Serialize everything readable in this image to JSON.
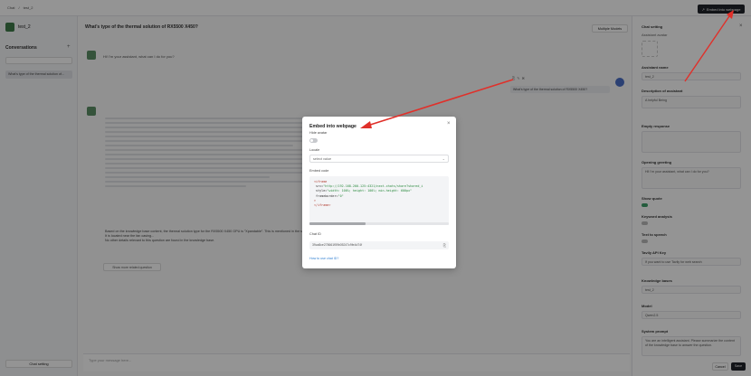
{
  "topbar": {
    "breadcrumb": [
      "Chat",
      "/",
      "test_2"
    ],
    "embed_button": "Embed into webpage"
  },
  "sidebar": {
    "app_name": "test_2",
    "section_title": "Conversations",
    "conversation": "What's type of the thermal solution of...",
    "chat_setting": "Chat setting"
  },
  "main": {
    "question_title": "What's type of the thermal solution of RX5500 X450?",
    "multiple_models": "Multiple Models",
    "greeting": "Hi! I'm your assistant, what can I do for you?",
    "user_question": "What's type of the thermal solution of RX5500 X450?",
    "answer": "Based on the knowledge base content, the thermal solution type for the RX5500 X450 GPU is \"Xpandable\". This is mentioned in the section... which is available in the document. For a detailed breakdown...",
    "answer_line2": "It is located near the fan casing...",
    "answer_line3": "No other details relevant to this question are found in the knowledge base.",
    "related": "Show more related question",
    "input_placeholder": "Type your message here..."
  },
  "right_panel": {
    "title": "Chat setting",
    "assistant_avatar": "Assistant avatar",
    "assistant_name_label": "Assistant name",
    "assistant_name": "test_2",
    "description_label": "Description of assistant",
    "description": "A helpful Being",
    "empty_response_label": "Empty response",
    "opening_greeting_label": "Opening greeting",
    "opening_greeting": "Hi! I'm your assistant, what can I do for you?",
    "show_quote_label": "Show quote",
    "keyword_label": "Keyword analysis",
    "text_to_speech_label": "Text to speech",
    "tavily_label": "Tavily API Key",
    "tavily_placeholder": "If you want to use Tavily for web search",
    "knowledge_bases_label": "Knowledge bases",
    "knowledge_base": "test_2",
    "model_label": "Model",
    "model_value": "Qwen2.5",
    "system_prompt_label": "System prompt",
    "system_prompt": "You are an intelligent assistant. Please summarize the content of the knowledge base to answer the question.",
    "cancel": "Cancel",
    "save": "Save"
  },
  "modal": {
    "title": "Embed into webpage",
    "hide_avatar_label": "Hide avatar",
    "locale_label": "Locale",
    "locale_placeholder": "select value",
    "embed_code_label": "Embed code",
    "code": {
      "line1": "<iframe",
      "line2_attr": "src=",
      "line2_val": "\"http://192.168.200.125:4321/next-chats/share?shared_i",
      "line3_attr": "style=",
      "line3_val": "\"width: 100%; height: 100%; min-height: 600px\"",
      "line4_attr": "frameborder=",
      "line4_val": "\"0\"",
      "line5": ">",
      "line6": "</iframe>"
    },
    "chat_id_label": "Chat ID",
    "chat_id": "39ca8ce278661f59b05247c9fe4d74f",
    "how_to_link": "How to use chat ID?"
  }
}
